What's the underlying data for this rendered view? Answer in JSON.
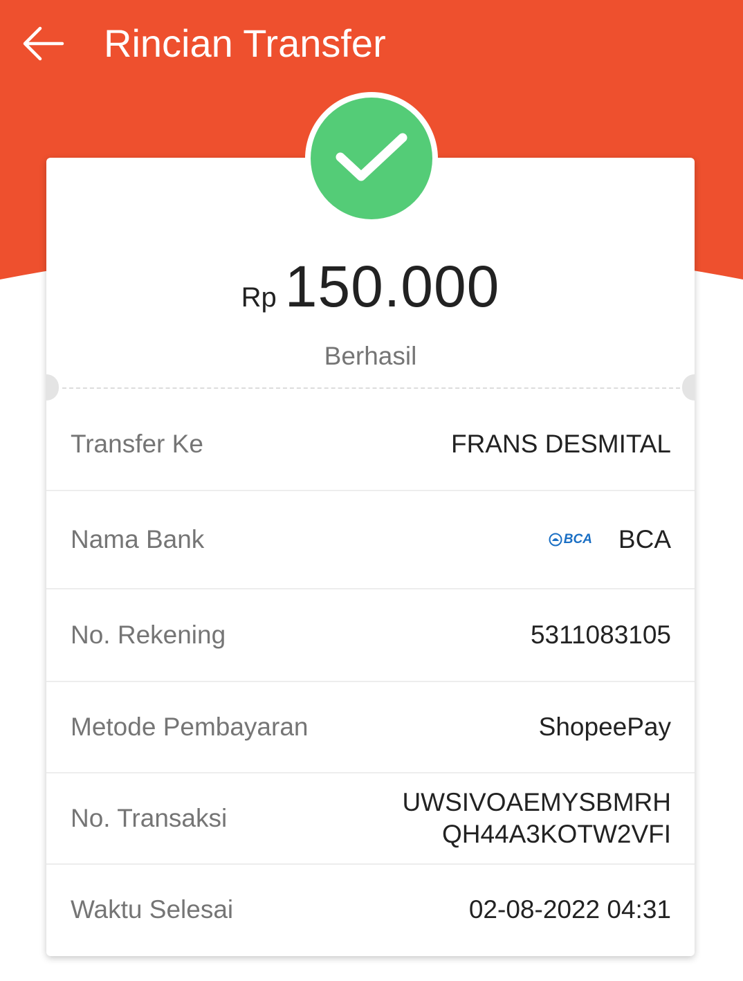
{
  "colors": {
    "header": "#ee502e",
    "success": "#54cc77",
    "label": "#757575",
    "value": "#222222",
    "bank_brand": "#1a6fc4"
  },
  "header": {
    "back_icon": "arrow-left-icon",
    "title": "Rincian Transfer"
  },
  "summary": {
    "status_icon": "checkmark-icon",
    "currency": "Rp",
    "amount": "150.000",
    "status": "Berhasil"
  },
  "details": [
    {
      "label": "Transfer Ke",
      "value": "FRANS DESMITAL"
    },
    {
      "label": "Nama Bank",
      "value": "BCA",
      "logo_text": "BCA",
      "logo_icon": "bca-logo-icon"
    },
    {
      "label": "No. Rekening",
      "value": "5311083105"
    },
    {
      "label": "Metode Pembayaran",
      "value": "ShopeePay"
    },
    {
      "label": "No. Transaksi",
      "value_lines": [
        "UWSIVOAEMYSBMRH",
        "QH44A3KOTW2VFI"
      ]
    },
    {
      "label": "Waktu Selesai",
      "value": "02-08-2022 04:31"
    }
  ]
}
